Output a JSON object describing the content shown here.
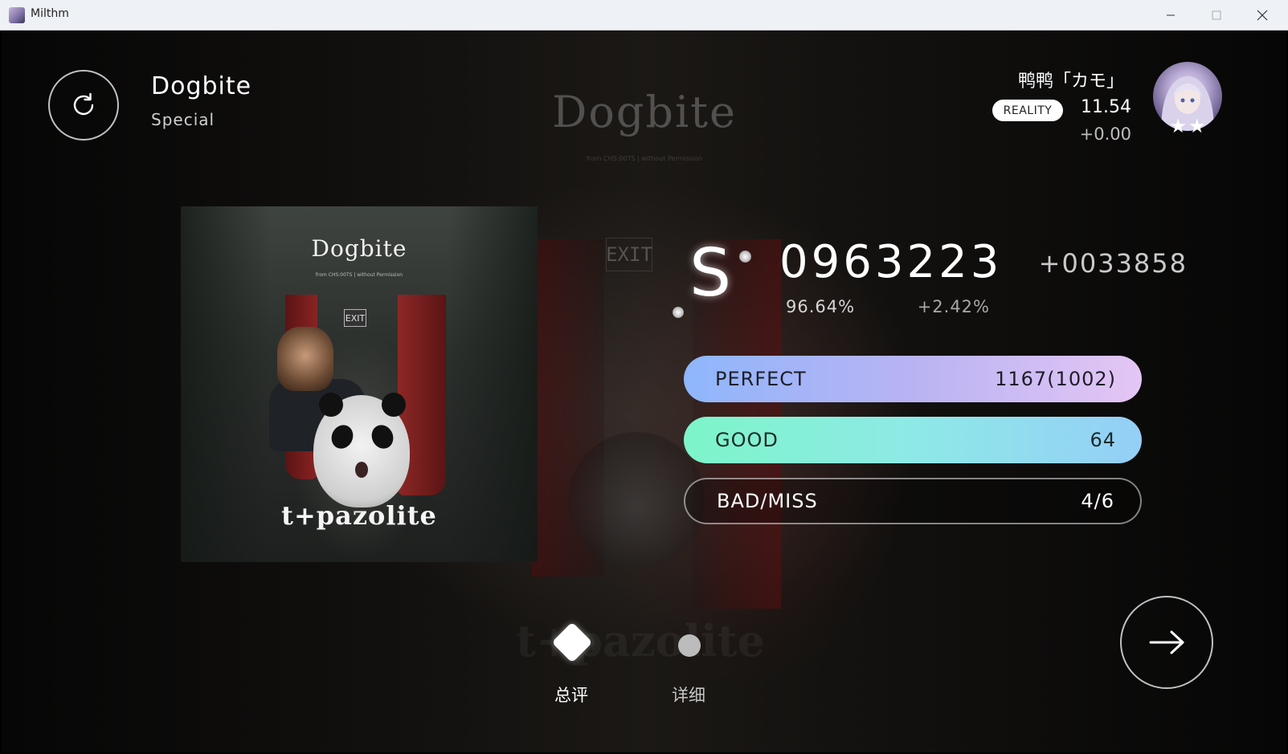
{
  "window": {
    "title": "Milthm",
    "icons": {
      "app": "app-icon",
      "minimize": "minimize-icon",
      "maximize": "maximize-icon",
      "close": "close-icon"
    }
  },
  "background": {
    "title": "Dogbite",
    "subtitle": "from\nCHS:00TS | without Permission",
    "exit_sign": "EXIT",
    "artist": "t+pazolite"
  },
  "song": {
    "title": "Dogbite",
    "difficulty": "Special",
    "retry_icon": "retry-icon"
  },
  "player": {
    "name": "鸭鸭「カモ」",
    "badge": "REALITY",
    "rating": "11.54",
    "rating_delta": "+0.00",
    "stars": "★★"
  },
  "cover": {
    "title": "Dogbite",
    "subtitle": "from CHS:00TS | without Permission",
    "exit_sign": "EXIT",
    "artist": "t+pazolite"
  },
  "result": {
    "rank": "S",
    "score": "0963223",
    "score_delta": "+0033858",
    "accuracy": "96.64%",
    "accuracy_delta": "+2.42%"
  },
  "judgements": [
    {
      "label": "PERFECT",
      "value": "1167(1002)",
      "color_from": "#8fb6fb",
      "color_to": "#e4c6f4"
    },
    {
      "label": "GOOD",
      "value": "64",
      "color_from": "#7df5c9",
      "color_to": "#95cef7"
    },
    {
      "label": "BAD/MISS",
      "value": "4/6"
    }
  ],
  "tabs": [
    {
      "label": "总评",
      "active": true,
      "icon": "diamond-icon"
    },
    {
      "label": "详细",
      "active": false,
      "icon": "dot-icon"
    }
  ],
  "next_icon": "arrow-right-icon"
}
